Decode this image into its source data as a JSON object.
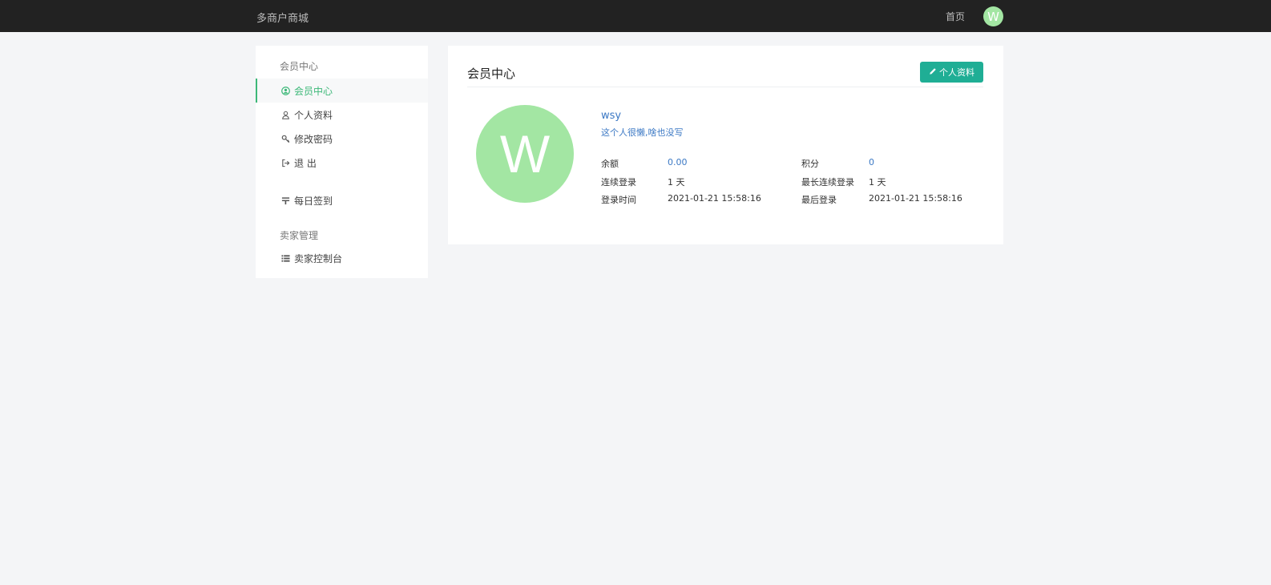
{
  "colors": {
    "topbar_bg": "#222222",
    "accent_green": "#3cb878",
    "button_teal": "#1fae95",
    "link_blue": "#3b78c4",
    "avatar_green": "#a3e6a3"
  },
  "topbar": {
    "brand": "多商户商城",
    "home_label": "首页",
    "avatar_letter": "W"
  },
  "sidebar": {
    "group1_title": "会员中心",
    "items": [
      {
        "label": "会员中心",
        "icon": "user-circle-icon",
        "active": true
      },
      {
        "label": "个人资料",
        "icon": "user-outline-icon",
        "active": false
      },
      {
        "label": "修改密码",
        "icon": "key-icon",
        "active": false
      },
      {
        "label": "退 出",
        "icon": "sign-out-icon",
        "active": false
      },
      {
        "label": "每日签到",
        "icon": "checkin-icon",
        "active": false
      }
    ],
    "group2_title": "卖家管理",
    "seller_item": {
      "label": "卖家控制台",
      "icon": "list-icon"
    }
  },
  "main": {
    "title": "会员中心",
    "edit_button_label": "个人资料",
    "avatar_letter": "W",
    "username": "wsy",
    "bio": "这个人很懒,啥也没写",
    "stats": {
      "balance_label": "余额",
      "balance_value": "0.00",
      "points_label": "积分",
      "points_value": "0",
      "streak_label": "连续登录",
      "streak_value": "1 天",
      "longest_streak_label": "最长连续登录",
      "longest_streak_value": "1 天",
      "login_time_label": "登录时间",
      "login_time_value": "2021-01-21 15:58:16",
      "last_login_label": "最后登录",
      "last_login_value": "2021-01-21 15:58:16"
    }
  }
}
